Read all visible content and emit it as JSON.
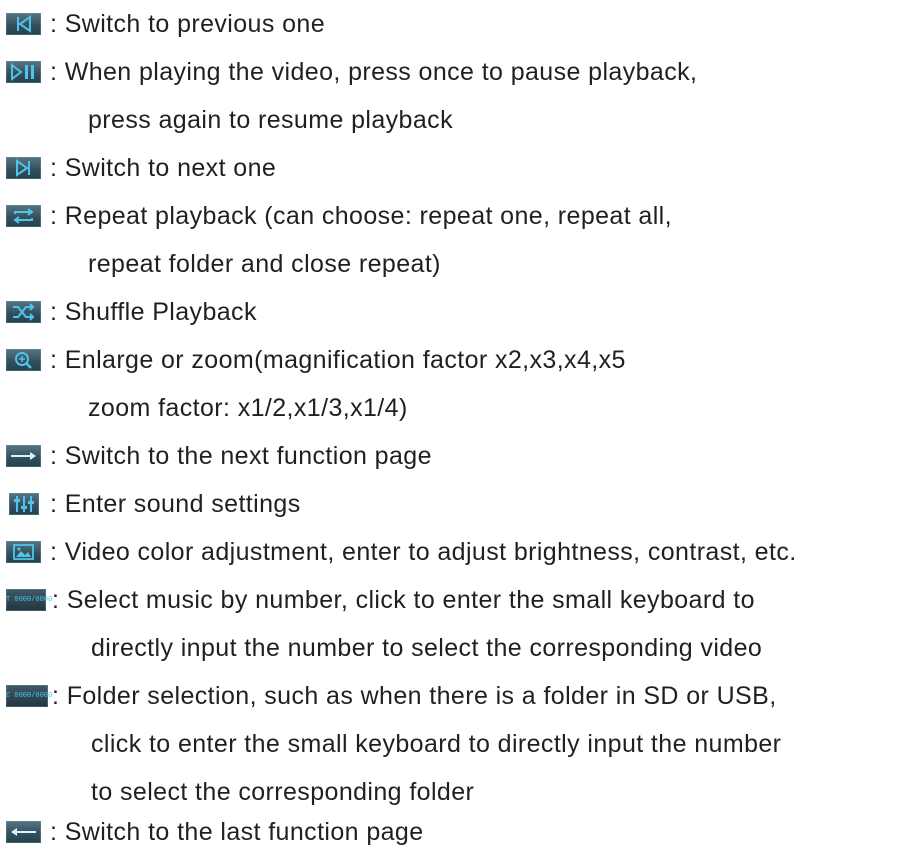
{
  "items": [
    {
      "icon": "previous-icon",
      "lines": [
        ": Switch to previous one"
      ]
    },
    {
      "icon": "play-pause-icon",
      "lines": [
        ": When playing the video, press once to pause playback,",
        "press again to resume playback"
      ]
    },
    {
      "icon": "next-icon",
      "lines": [
        ": Switch to next one"
      ]
    },
    {
      "icon": "repeat-icon",
      "lines": [
        ": Repeat playback (can choose: repeat one, repeat all,",
        "repeat folder and close repeat)"
      ]
    },
    {
      "icon": "shuffle-icon",
      "lines": [
        ": Shuffle Playback"
      ]
    },
    {
      "icon": "zoom-icon",
      "lines": [
        ": Enlarge or zoom(magnification factor x2,x3,x4,x5",
        "zoom factor: x1/2,x1/3,x1/4)"
      ]
    },
    {
      "icon": "next-page-arrow-icon",
      "lines": [
        ": Switch to the next function page"
      ]
    },
    {
      "icon": "sound-settings-icon",
      "lines": [
        ": Enter sound settings"
      ]
    },
    {
      "icon": "picture-icon",
      "lines": [
        ": Video color adjustment, enter to adjust brightness, contrast, etc."
      ]
    },
    {
      "icon": "track-number-icon",
      "icon_text": "T 0000/0000",
      "lines": [
        ": Select music by number, click to enter the small keyboard to",
        "directly input the number to select the corresponding video"
      ]
    },
    {
      "icon": "folder-number-icon",
      "icon_text": "C 0000/0000",
      "lines": [
        ": Folder selection, such as when there is a folder in SD or USB,",
        "click to enter the small keyboard to directly input the number",
        "to select the corresponding folder"
      ]
    },
    {
      "icon": "previous-page-arrow-icon",
      "lines": [
        ": Switch to the last function page"
      ]
    }
  ],
  "colors": {
    "text": "#231f20",
    "icon_bg": "#33505e",
    "icon_glyph": "#4fc3e8"
  }
}
